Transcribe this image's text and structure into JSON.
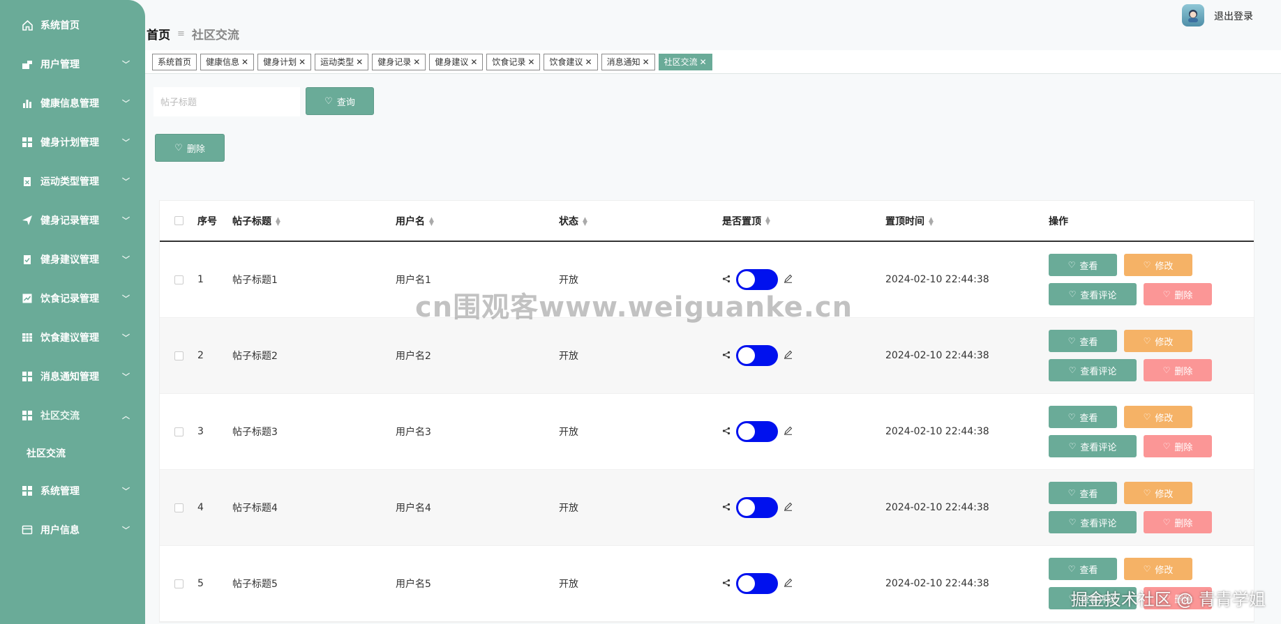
{
  "sidebar": {
    "items": [
      {
        "label": "系统首页",
        "icon": "home-icon",
        "expand": false
      },
      {
        "label": "用户管理",
        "icon": "user-icon",
        "expand": true
      },
      {
        "label": "健康信息管理",
        "icon": "chart-icon",
        "expand": true
      },
      {
        "label": "健身计划管理",
        "icon": "grid-icon",
        "expand": true
      },
      {
        "label": "运动类型管理",
        "icon": "clipboard-icon",
        "expand": true
      },
      {
        "label": "健身记录管理",
        "icon": "send-icon",
        "expand": true
      },
      {
        "label": "健身建议管理",
        "icon": "clipboard-check-icon",
        "expand": true
      },
      {
        "label": "饮食记录管理",
        "icon": "trend-icon",
        "expand": true
      },
      {
        "label": "饮食建议管理",
        "icon": "table-icon",
        "expand": true
      },
      {
        "label": "消息通知管理",
        "icon": "grid-icon",
        "expand": true
      },
      {
        "label": "社区交流",
        "icon": "grid-icon",
        "expand": true,
        "open": true
      }
    ],
    "sub_item": "社区交流",
    "bottom_items": [
      {
        "label": "系统管理",
        "icon": "grid-icon"
      },
      {
        "label": "用户信息",
        "icon": "card-icon"
      }
    ]
  },
  "header": {
    "logout": "退出登录",
    "breadcrumb_home": "首页",
    "breadcrumb_sep": "≡",
    "breadcrumb_current": "社区交流"
  },
  "tabs": [
    {
      "label": "系统首页",
      "closable": false
    },
    {
      "label": "健康信息",
      "closable": true
    },
    {
      "label": "健身计划",
      "closable": true
    },
    {
      "label": "运动类型",
      "closable": true
    },
    {
      "label": "健身记录",
      "closable": true
    },
    {
      "label": "健身建议",
      "closable": true
    },
    {
      "label": "饮食记录",
      "closable": true
    },
    {
      "label": "饮食建议",
      "closable": true
    },
    {
      "label": "消息通知",
      "closable": true
    },
    {
      "label": "社区交流",
      "closable": true,
      "active": true
    }
  ],
  "search": {
    "placeholder": "帖子标题",
    "query_label": "查询",
    "delete_label": "删除"
  },
  "table": {
    "headers": {
      "idx": "序号",
      "title": "帖子标题",
      "user": "用户名",
      "status": "状态",
      "top": "是否置顶",
      "time": "置顶时间",
      "ops": "操作"
    },
    "rows": [
      {
        "idx": "1",
        "title": "帖子标题1",
        "user": "用户名1",
        "status": "开放",
        "time": "2024-02-10 22:44:38"
      },
      {
        "idx": "2",
        "title": "帖子标题2",
        "user": "用户名2",
        "status": "开放",
        "time": "2024-02-10 22:44:38"
      },
      {
        "idx": "3",
        "title": "帖子标题3",
        "user": "用户名3",
        "status": "开放",
        "time": "2024-02-10 22:44:38"
      },
      {
        "idx": "4",
        "title": "帖子标题4",
        "user": "用户名4",
        "status": "开放",
        "time": "2024-02-10 22:44:38"
      },
      {
        "idx": "5",
        "title": "帖子标题5",
        "user": "用户名5",
        "status": "开放",
        "time": "2024-02-10 22:44:38"
      }
    ],
    "ops": {
      "view": "查看",
      "edit": "修改",
      "comments": "查看评论",
      "delete": "删除"
    }
  },
  "watermarks": {
    "center": "cn围观客www.weiguanke.cn",
    "corner": "掘金技术社区 @ 青青学姐"
  },
  "colors": {
    "accent": "#6aab98",
    "edit": "#f5b266",
    "delete": "#fb9696",
    "switch": "#0011ee"
  }
}
